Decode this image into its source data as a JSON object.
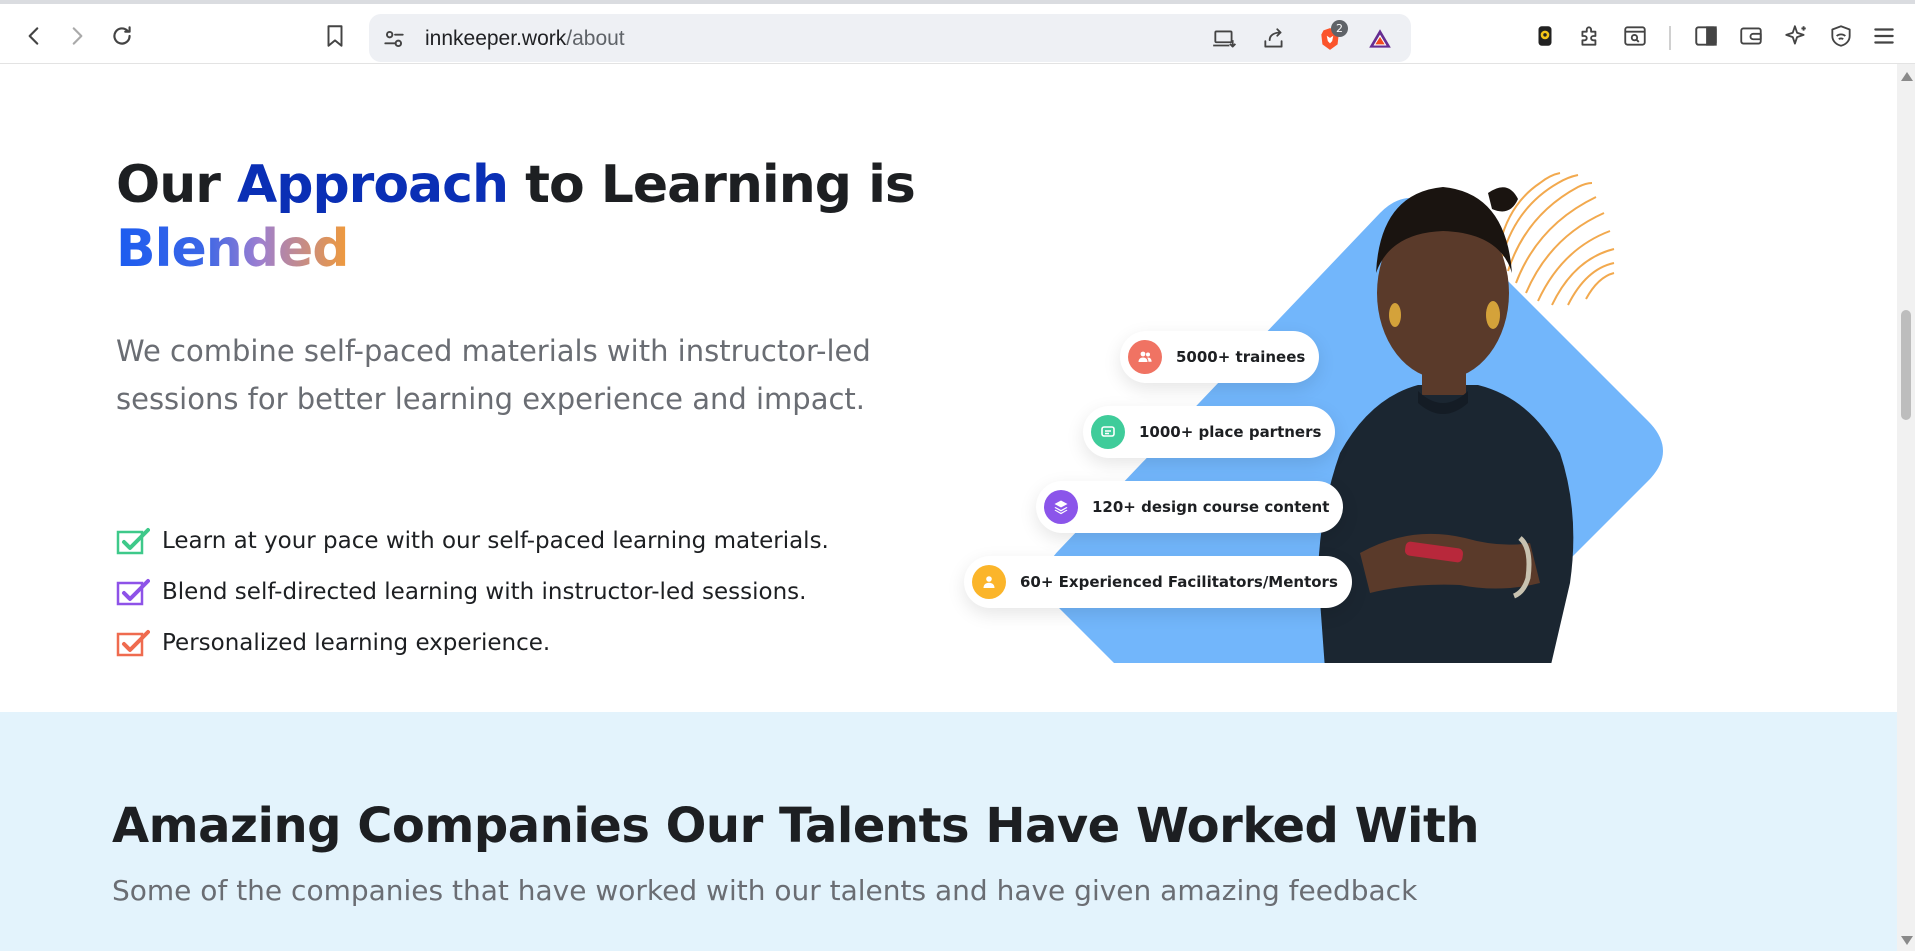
{
  "browser": {
    "url_host": "innkeeper.work",
    "url_path": "/about",
    "shields_count": "2"
  },
  "hero": {
    "title_part1": "Our ",
    "title_highlight": "Approach",
    "title_part2": " to Learning is",
    "title_gradient": "Blended",
    "description": "We combine self-paced materials with instructor-led sessions for better learning experience and impact.",
    "features": [
      {
        "text": "Learn at your pace with our self-paced learning materials.",
        "color": "#3ec98a"
      },
      {
        "text": "Blend self-directed learning with instructor-led sessions.",
        "color": "#8e52e8"
      },
      {
        "text": "Personalized learning experience.",
        "color": "#ef6b4f"
      }
    ],
    "stats": [
      {
        "text": "5000+ trainees",
        "color": "#f07363",
        "icon": "users-icon"
      },
      {
        "text": "1000+ place partners",
        "color": "#3fcc9a",
        "icon": "chat-icon"
      },
      {
        "text": "120+ design course content",
        "color": "#8b55ea",
        "icon": "layers-icon"
      },
      {
        "text": "60+ Experienced Facilitators/Mentors",
        "color": "#fbb52a",
        "icon": "user-icon"
      }
    ]
  },
  "companies": {
    "title": "Amazing Companies Our Talents Have Worked With",
    "subtitle": "Some of the companies that have worked with our talents and have given amazing feedback"
  }
}
